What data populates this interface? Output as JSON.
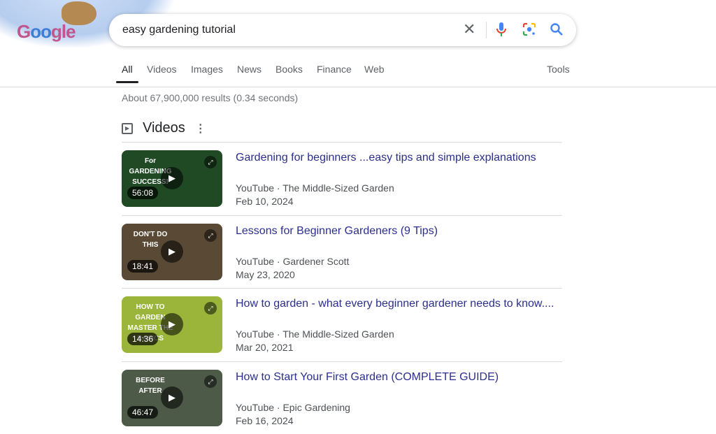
{
  "search": {
    "query": "easy gardening tutorial"
  },
  "logo": {
    "text": "Google"
  },
  "tabs": [
    {
      "label": "All",
      "active": true
    },
    {
      "label": "Videos"
    },
    {
      "label": "Images"
    },
    {
      "label": "News"
    },
    {
      "label": "Books"
    },
    {
      "label": "Finance"
    },
    {
      "label": "Web"
    }
  ],
  "tools_label": "Tools",
  "stats": "About 67,900,000 results (0.34 seconds)",
  "videos_section": {
    "heading": "Videos",
    "items": [
      {
        "title": "Gardening for beginners ...easy tips and simple explanations",
        "source": "YouTube",
        "channel": "The Middle-Sized Garden",
        "date": "Feb 10, 2024",
        "duration": "56:08",
        "thumb_text": "For GARDENING SUCCESS!",
        "thumb_color": "#1f4a24"
      },
      {
        "title": "Lessons for Beginner Gardeners (9 Tips)",
        "source": "YouTube",
        "channel": "Gardener Scott",
        "date": "May 23, 2020",
        "duration": "18:41",
        "thumb_text": "DON'T DO THIS",
        "thumb_color": "#5a4a35"
      },
      {
        "title": "How to garden - what every beginner gardener needs to know....",
        "source": "YouTube",
        "channel": "The Middle-Sized Garden",
        "date": "Mar 20, 2021",
        "duration": "14:36",
        "thumb_text": "HOW TO GARDEN MASTER THE BASICS",
        "thumb_color": "#9bb53a"
      },
      {
        "title": "How to Start Your First Garden (COMPLETE GUIDE)",
        "source": "YouTube",
        "channel": "Epic Gardening",
        "date": "Feb 16, 2024",
        "duration": "46:47",
        "thumb_text": "BEFORE AFTER",
        "thumb_color": "#4d5a48"
      }
    ]
  }
}
